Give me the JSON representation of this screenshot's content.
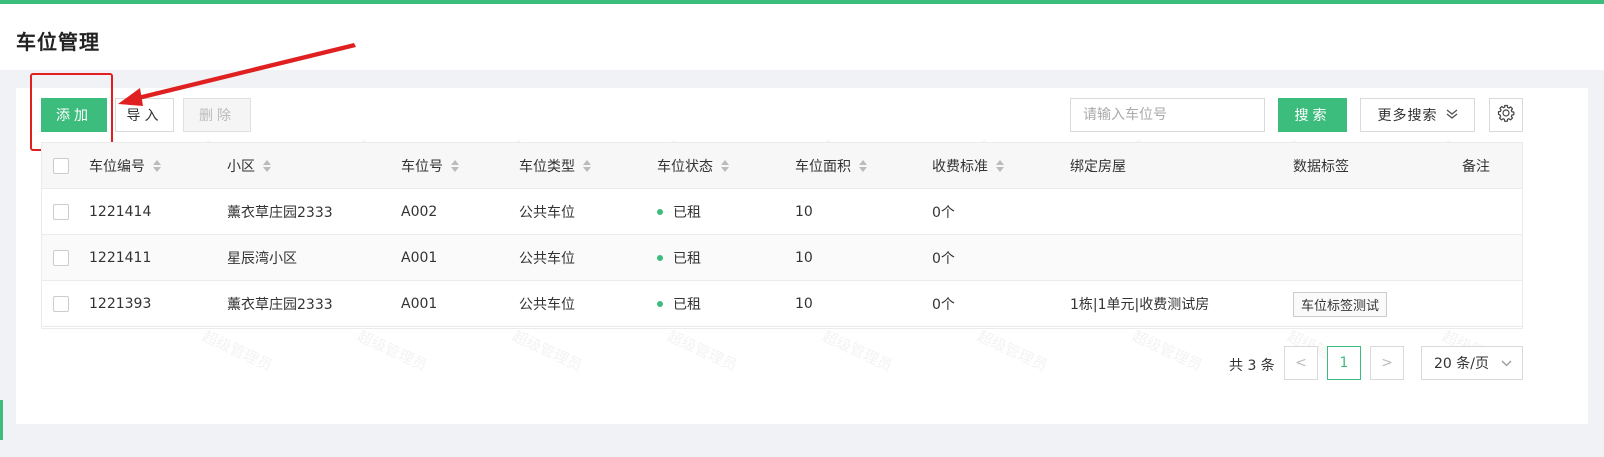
{
  "page": {
    "title": "车位管理"
  },
  "toolbar": {
    "add_label": "添加",
    "import_label": "导入",
    "delete_label": "删除",
    "search_placeholder": "请输入车位号",
    "search_label": "搜索",
    "more_search_label": "更多搜索"
  },
  "table": {
    "headers": {
      "code": "车位编号",
      "community": "小区",
      "spot_no": "车位号",
      "type": "车位类型",
      "status": "车位状态",
      "area": "车位面积",
      "fee": "收费标准",
      "house": "绑定房屋",
      "tags": "数据标签",
      "remark": "备注"
    },
    "rows": [
      {
        "code": "1221414",
        "community": "薰衣草庄园2333",
        "spot_no": "A002",
        "type": "公共车位",
        "status": "已租",
        "area": "10",
        "fee": "0个",
        "house": "",
        "tag": ""
      },
      {
        "code": "1221411",
        "community": "星辰湾小区",
        "spot_no": "A001",
        "type": "公共车位",
        "status": "已租",
        "area": "10",
        "fee": "0个",
        "house": "",
        "tag": ""
      },
      {
        "code": "1221393",
        "community": "薰衣草庄园2333",
        "spot_no": "A001",
        "type": "公共车位",
        "status": "已租",
        "area": "10",
        "fee": "0个",
        "house": "1栋|1单元|收费测试房",
        "tag": "车位标签测试"
      }
    ]
  },
  "pagination": {
    "total_text": "共 3 条",
    "prev": "<",
    "current_page": "1",
    "next": ">",
    "page_size": "20 条/页"
  },
  "watermark": {
    "text": "超级管理员"
  },
  "colors": {
    "accent": "#3dbd7d",
    "highlight": "#e02020",
    "status_dot": "#3dbd7d"
  },
  "icons": {
    "settings": "gear-icon",
    "more_search": "double-chevron-down-icon",
    "sort": "sort-icon",
    "annotation_arrow": "arrow-icon"
  }
}
